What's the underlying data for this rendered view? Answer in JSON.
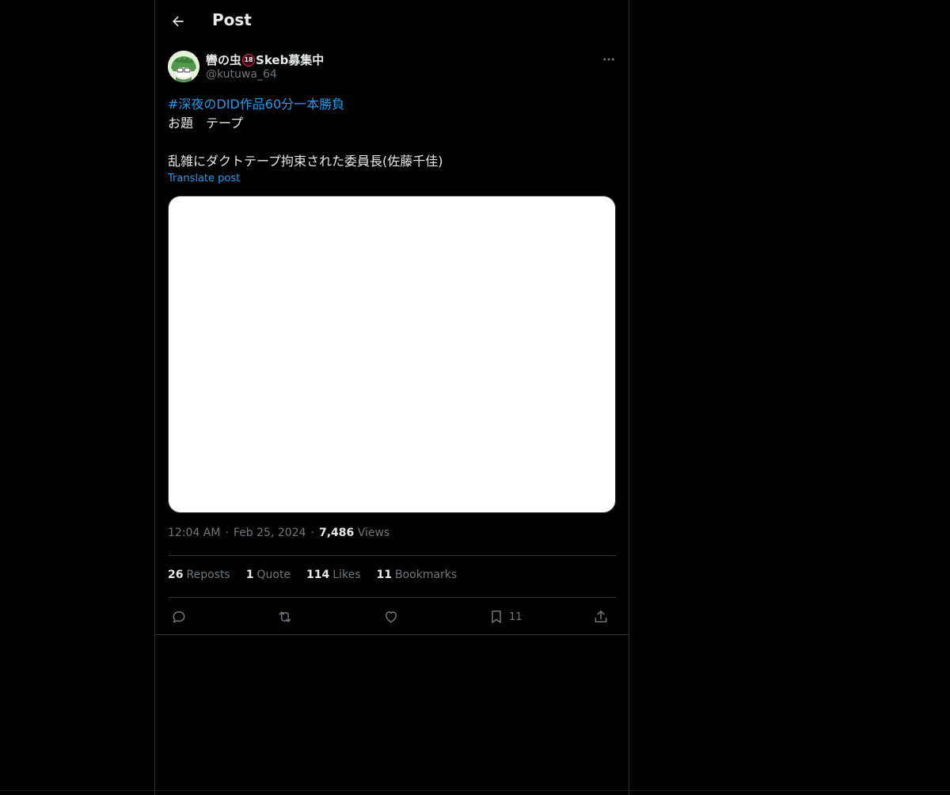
{
  "header": {
    "title": "Post"
  },
  "author": {
    "name_prefix": "轡の虫",
    "badge": "18",
    "name_suffix": "Skeb募集中",
    "handle": "@kutuwa_64"
  },
  "post": {
    "hashtag": "#深夜のDID作品60分一本勝負",
    "line2": "お題　テープ",
    "line3": "",
    "line4": "乱雑にダクトテープ拘束された委員長(佐藤千佳)",
    "translate": "Translate post"
  },
  "meta": {
    "time": "12:04 AM",
    "date": "Feb 25, 2024",
    "views_count": "7,486",
    "views_label": "Views"
  },
  "stats": {
    "reposts_count": "26",
    "reposts_label": "Reposts",
    "quote_count": "1",
    "quote_label": "Quote",
    "likes_count": "114",
    "likes_label": "Likes",
    "bookmarks_count": "11",
    "bookmarks_label": "Bookmarks"
  },
  "actions": {
    "bookmark_count": "11"
  },
  "colors": {
    "background": "#000000",
    "text": "#e7e9ea",
    "muted": "#71767b",
    "link": "#1d9bf0",
    "border": "#2f3336"
  },
  "icons": [
    "back-arrow-icon",
    "more-icon",
    "reply-icon",
    "repost-icon",
    "like-icon",
    "bookmark-icon",
    "share-icon"
  ]
}
